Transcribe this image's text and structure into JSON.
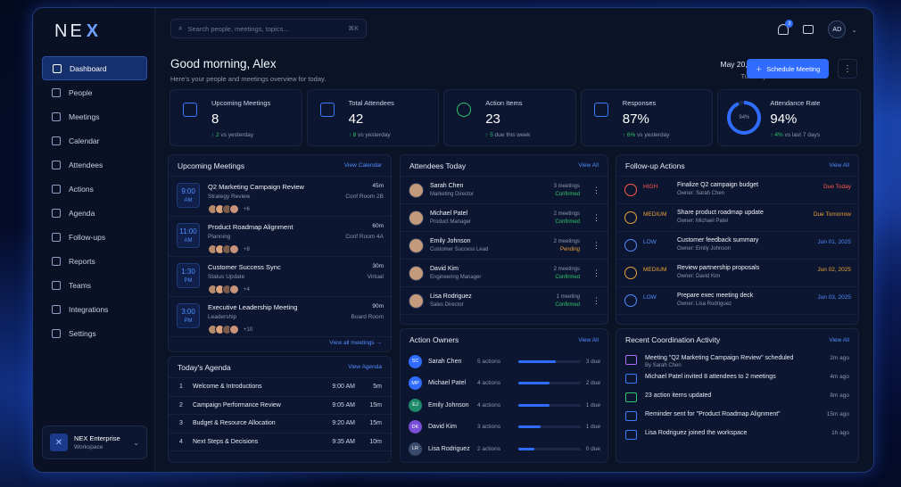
{
  "brand": {
    "name": "NE",
    "name_x": "X"
  },
  "sidebar": {
    "items": [
      {
        "label": "Dashboard",
        "icon": "dashboard-icon",
        "active": true
      },
      {
        "label": "People",
        "icon": "people-icon"
      },
      {
        "label": "Meetings",
        "icon": "meetings-icon"
      },
      {
        "label": "Calendar",
        "icon": "calendar-icon"
      },
      {
        "label": "Attendees",
        "icon": "attendees-icon"
      },
      {
        "label": "Actions",
        "icon": "actions-icon"
      },
      {
        "label": "Agenda",
        "icon": "agenda-icon"
      },
      {
        "label": "Follow-ups",
        "icon": "follow-ups-icon"
      },
      {
        "label": "Reports",
        "icon": "reports-icon"
      },
      {
        "label": "Teams",
        "icon": "teams-icon"
      },
      {
        "label": "Integrations",
        "icon": "integrations-icon"
      },
      {
        "label": "Settings",
        "icon": "settings-icon"
      }
    ],
    "workspace": {
      "name": "NEX Enterprise",
      "sub": "Workspace"
    }
  },
  "search": {
    "placeholder": "Search people, meetings, topics...",
    "shortcut": "⌘K"
  },
  "header": {
    "notifications_count": "3",
    "avatar": "AD",
    "greeting": "Good morning, Alex",
    "subtitle": "Here's your people and meetings overview for today.",
    "date": "May 20, 2025",
    "weekday": "Tuesday",
    "schedule_label": "Schedule Meeting"
  },
  "stats": [
    {
      "label": "Upcoming Meetings",
      "value": "8",
      "delta": "↑ 2",
      "note": "vs yesterday"
    },
    {
      "label": "Total Attendees",
      "value": "42",
      "delta": "↑ 8",
      "note": "vs yesterday"
    },
    {
      "label": "Action Items",
      "value": "23",
      "delta": "↑ 5",
      "note": "due this week"
    },
    {
      "label": "Responses",
      "value": "87%",
      "delta": "↑ 6%",
      "note": "vs yesterday"
    },
    {
      "label": "Attendance Rate",
      "value": "94%",
      "delta": "↑ 4%",
      "note": "vs last 7 days",
      "ring": "94%"
    }
  ],
  "upcoming": {
    "title": "Upcoming Meetings",
    "link": "View Calendar",
    "footer": "View all meetings →",
    "items": [
      {
        "hour": "9:00",
        "ampm": "AM",
        "name": "Q2 Marketing Campaign Review",
        "cat": "Strategy Review",
        "dur": "45m",
        "room": "Conf Room 2B",
        "more": "+6"
      },
      {
        "hour": "11:00",
        "ampm": "AM",
        "name": "Product Roadmap Alignment",
        "cat": "Planning",
        "dur": "60m",
        "room": "Conf Room 4A",
        "more": "+8"
      },
      {
        "hour": "1:30",
        "ampm": "PM",
        "name": "Customer Success Sync",
        "cat": "Status Update",
        "dur": "30m",
        "room": "Virtual",
        "more": "+4"
      },
      {
        "hour": "3:00",
        "ampm": "PM",
        "name": "Executive Leadership Meeting",
        "cat": "Leadership",
        "dur": "90m",
        "room": "Board Room",
        "more": "+10"
      }
    ]
  },
  "agenda": {
    "title": "Today's Agenda",
    "link": "View Agenda",
    "items": [
      {
        "n": "1",
        "title": "Welcome & Introductions",
        "time": "9:00 AM",
        "dur": "5m"
      },
      {
        "n": "2",
        "title": "Campaign Performance Review",
        "time": "9:05 AM",
        "dur": "15m"
      },
      {
        "n": "3",
        "title": "Budget & Resource Allocation",
        "time": "9:20 AM",
        "dur": "15m"
      },
      {
        "n": "4",
        "title": "Next Steps & Decisions",
        "time": "9:35 AM",
        "dur": "10m"
      }
    ]
  },
  "attendees": {
    "title": "Attendees Today",
    "link": "View All",
    "items": [
      {
        "name": "Sarah Chen",
        "role": "Marketing Director",
        "meetings": "3 meetings",
        "status": "Confirmed",
        "color": "#31c46b"
      },
      {
        "name": "Michael Patel",
        "role": "Product Manager",
        "meetings": "2 meetings",
        "status": "Confirmed",
        "color": "#31c46b"
      },
      {
        "name": "Emily Johnson",
        "role": "Customer Success Lead",
        "meetings": "2 meetings",
        "status": "Pending",
        "color": "#e9a23a"
      },
      {
        "name": "David Kim",
        "role": "Engineering Manager",
        "meetings": "2 meetings",
        "status": "Confirmed",
        "color": "#31c46b"
      },
      {
        "name": "Lisa Rodriguez",
        "role": "Sales Director",
        "meetings": "1 meeting",
        "status": "Confirmed",
        "color": "#31c46b"
      }
    ]
  },
  "followups": {
    "title": "Follow-up Actions",
    "link": "View All",
    "items": [
      {
        "priority": "HIGH",
        "pcolor": "#ff5a4a",
        "name": "Finalize Q2 campaign budget",
        "owner": "Owner: Sarah Chen",
        "due": "Due Today",
        "dcolor": "#ff5a4a"
      },
      {
        "priority": "MEDIUM",
        "pcolor": "#e9a23a",
        "name": "Share product roadmap update",
        "owner": "Owner: Michael Patel",
        "due": "Due Tomorrow",
        "dcolor": "#e9a23a"
      },
      {
        "priority": "LOW",
        "pcolor": "#4f8dff",
        "name": "Customer feedback summary",
        "owner": "Owner: Emily Johnson",
        "due": "Jun 01, 2025",
        "dcolor": "#4f8dff"
      },
      {
        "priority": "MEDIUM",
        "pcolor": "#e9a23a",
        "name": "Review partnership proposals",
        "owner": "Owner: David Kim",
        "due": "Jun 02, 2025",
        "dcolor": "#e9a23a"
      },
      {
        "priority": "LOW",
        "pcolor": "#4f8dff",
        "name": "Prepare exec meeting deck",
        "owner": "Owner: Lisa Rodriguez",
        "due": "Jun 03, 2025",
        "dcolor": "#4f8dff"
      }
    ]
  },
  "owners": {
    "title": "Action Owners",
    "link": "View All",
    "items": [
      {
        "initials": "SC",
        "name": "Sarah Chen",
        "actions": "5 actions",
        "progress": 0.6,
        "due": "3 due",
        "color": "#2f6cff"
      },
      {
        "initials": "MP",
        "name": "Michael Patel",
        "actions": "4 actions",
        "progress": 0.5,
        "due": "2 due",
        "color": "#2f6cff"
      },
      {
        "initials": "EJ",
        "name": "Emily Johnson",
        "actions": "4 actions",
        "progress": 0.5,
        "due": "1 due",
        "color": "#1e8a6a"
      },
      {
        "initials": "DK",
        "name": "David Kim",
        "actions": "3 actions",
        "progress": 0.35,
        "due": "1 due",
        "color": "#7a4fd8"
      },
      {
        "initials": "LR",
        "name": "Lisa Rodriguez",
        "actions": "2 actions",
        "progress": 0.25,
        "due": "0 due",
        "color": "#3a4a6d"
      }
    ]
  },
  "activity": {
    "title": "Recent Coordination Activity",
    "link": "View All",
    "items": [
      {
        "text": "Meeting \"Q2 Marketing Campaign Review\" scheduled",
        "by": "By Sarah Chen",
        "time": "2m ago",
        "icon": "calendar-icon",
        "color": "#b06cff"
      },
      {
        "text": "Michael Patel invited 8 attendees to 2 meetings",
        "by": "",
        "time": "4m ago",
        "icon": "people-icon",
        "color": "#3a7cff"
      },
      {
        "text": "23 action items updated",
        "by": "",
        "time": "8m ago",
        "icon": "check-icon",
        "color": "#31c46b"
      },
      {
        "text": "Reminder sent for \"Product Roadmap Alignment\"",
        "by": "",
        "time": "15m ago",
        "icon": "mail-icon",
        "color": "#3a7cff"
      },
      {
        "text": "Lisa Rodriguez joined the workspace",
        "by": "",
        "time": "1h ago",
        "icon": "user-add-icon",
        "color": "#3a7cff"
      }
    ]
  }
}
